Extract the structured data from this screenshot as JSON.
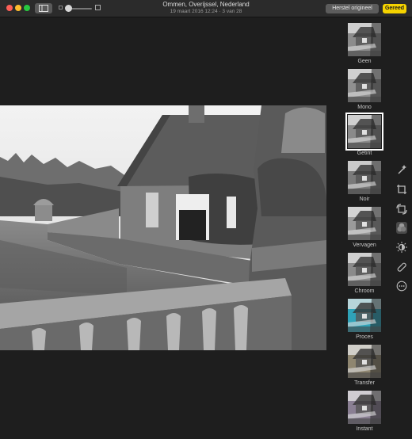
{
  "window": {
    "title": "Ommen, Overijssel, Nederland",
    "subtitle": "19 maart 2016 12:24  ·  3 van 28"
  },
  "toolbar": {
    "restore_label": "Herstel origineel",
    "done_label": "Gereed"
  },
  "tools": [
    "magic-wand-icon",
    "crop-icon",
    "rotate-icon",
    "filters-icon",
    "adjust-icon",
    "retouch-icon",
    "more-icon"
  ],
  "filters": [
    {
      "label": "Geen",
      "tint": "#8c8c8c"
    },
    {
      "label": "Mono",
      "tint": "#909090"
    },
    {
      "label": "Getint",
      "tint": "#8a8a8a",
      "selected": true
    },
    {
      "label": "Noir",
      "tint": "#7a7a7a"
    },
    {
      "label": "Vervagen",
      "tint": "#9a9a9a"
    },
    {
      "label": "Chroom",
      "tint": "#8a8a8a"
    },
    {
      "label": "Proces",
      "tint": "#2fa3b8"
    },
    {
      "label": "Transfer",
      "tint": "#8f8670"
    },
    {
      "label": "Instant",
      "tint": "#8a7f93"
    }
  ],
  "colors": {
    "accent": "#f5d300",
    "background": "#1e1e1e"
  }
}
